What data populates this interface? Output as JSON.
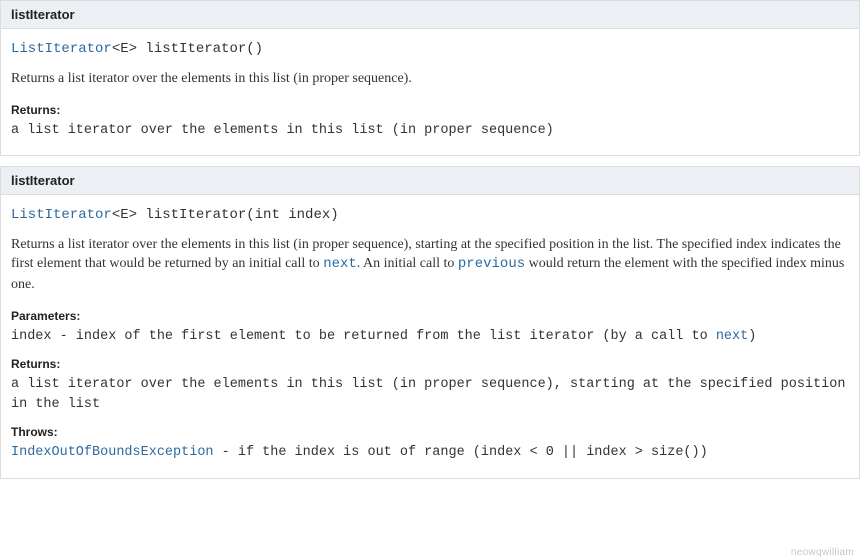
{
  "methods": [
    {
      "header": "listIterator",
      "sig_link": "ListIterator",
      "sig_rest": "<E> listIterator()",
      "desc_plain": "Returns a list iterator over the elements in this list (in proper sequence).",
      "returns_label": "Returns:",
      "returns_text": "a list iterator over the elements in this list (in proper sequence)"
    },
    {
      "header": "listIterator",
      "sig_link": "ListIterator",
      "sig_rest": "<E> listIterator(int index)",
      "desc_pre": "Returns a list iterator over the elements in this list (in proper sequence), starting at the specified position in the list. The specified index indicates the first element that would be returned by an initial call to ",
      "desc_next": "next",
      "desc_mid": ". An initial call to ",
      "desc_prev": "previous",
      "desc_post": " would return the element with the specified index minus one.",
      "params_label": "Parameters:",
      "params_pre": "index - index of the first element to be returned from the list iterator (by a call to ",
      "params_link": "next",
      "params_post": ")",
      "returns_label": "Returns:",
      "returns_text": "a list iterator over the elements in this list (in proper sequence), starting at the specified position in the list",
      "throws_label": "Throws:",
      "throws_link": "IndexOutOfBoundsException",
      "throws_text": " - if the index is out of range (index < 0 || index > size())"
    }
  ],
  "watermark": "neowqwilliam"
}
